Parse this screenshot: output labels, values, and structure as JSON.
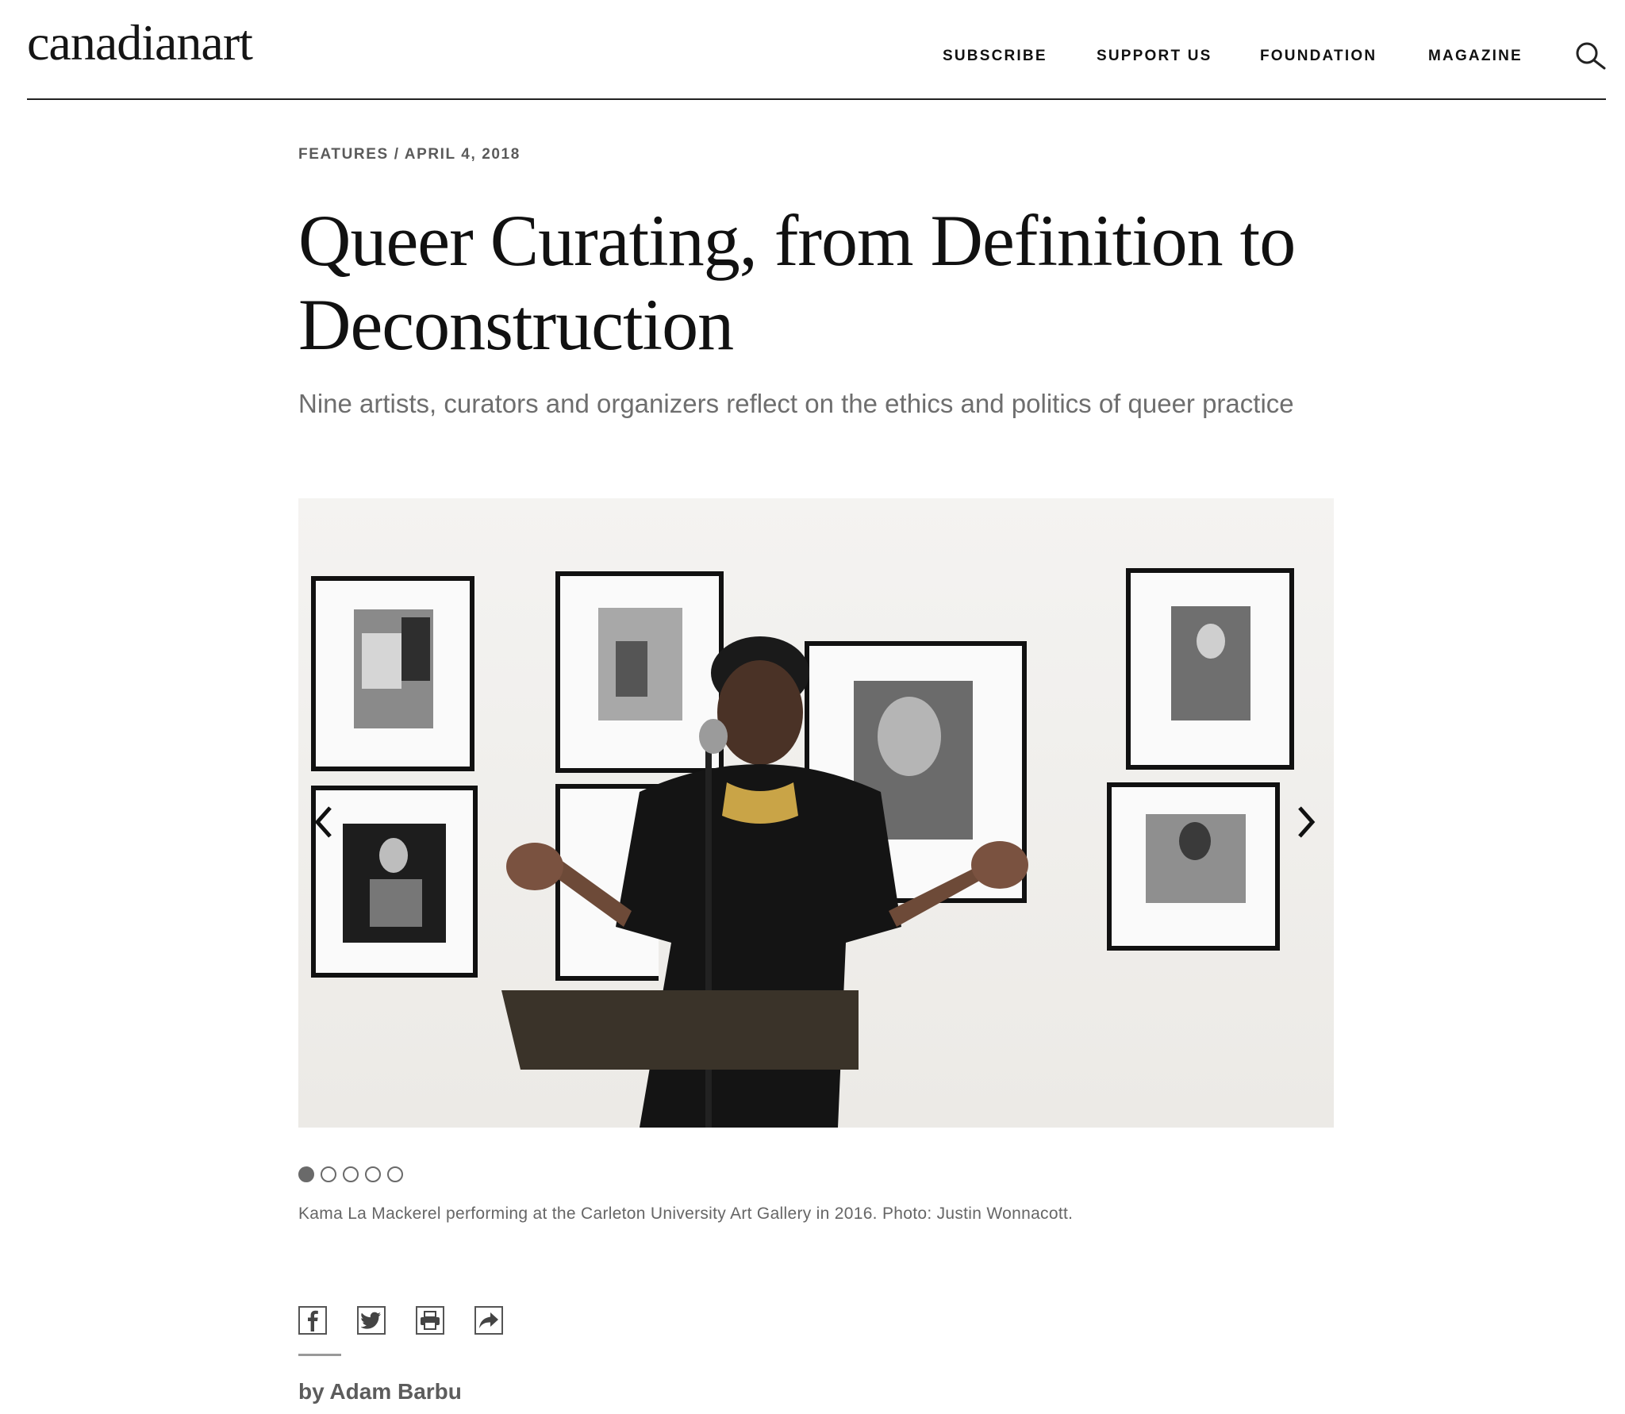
{
  "header": {
    "logo": "canadianart",
    "nav": [
      {
        "label": "SUBSCRIBE"
      },
      {
        "label": "SUPPORT US"
      },
      {
        "label": "FOUNDATION"
      },
      {
        "label": "MAGAZINE"
      }
    ],
    "search_icon": "search-icon"
  },
  "article": {
    "category": "FEATURES",
    "separator": "/",
    "date": "APRIL 4, 2018",
    "title": "Queer Curating, from Definition to Deconstruction",
    "subtitle": "Nine artists, curators and organizers reflect on the ethics and politics of queer practice",
    "byline": "by Adam Barbu"
  },
  "slideshow": {
    "slide_count": 5,
    "current_slide": 1,
    "caption": "Kama La Mackerel performing at the Carleton University Art Gallery in 2016. Photo: Justin Wonnacott.",
    "prev_icon": "chevron-left-icon",
    "next_icon": "chevron-right-icon"
  },
  "share": {
    "icons": [
      "facebook-icon",
      "twitter-icon",
      "print-icon",
      "share-arrow-icon"
    ]
  },
  "colors": {
    "text": "#111111",
    "muted": "#6e6e6e",
    "rule": "#222222"
  }
}
